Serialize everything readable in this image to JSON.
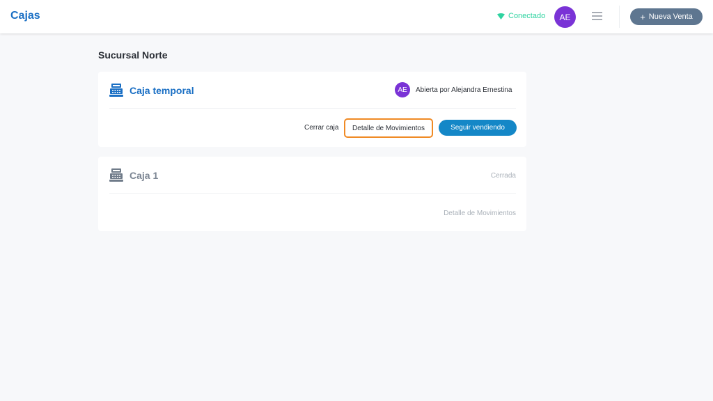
{
  "header": {
    "title": "Cajas",
    "status": "Conectado",
    "user_initials": "AE",
    "new_sale_label": "Nueva Venta",
    "colors": {
      "accent": "#1a6fc4",
      "status": "#2ed3a0",
      "avatar": "#7a33d6",
      "new_sale_bg": "#5e7690"
    }
  },
  "branch": {
    "name": "Sucursal Norte"
  },
  "registers": [
    {
      "name": "Caja temporal",
      "icon": "cash-register-icon",
      "owner_initials": "AE",
      "status_text": "Abierta por Alejandra Ernestina",
      "actions": {
        "close": "Cerrar caja",
        "movements": "Detalle de Movimientos",
        "continue": "Seguir vendiendo"
      }
    },
    {
      "name": "Caja 1",
      "icon": "cash-register-icon",
      "status_text": "Cerrada",
      "actions": {
        "movements": "Detalle de Movimientos"
      }
    }
  ]
}
